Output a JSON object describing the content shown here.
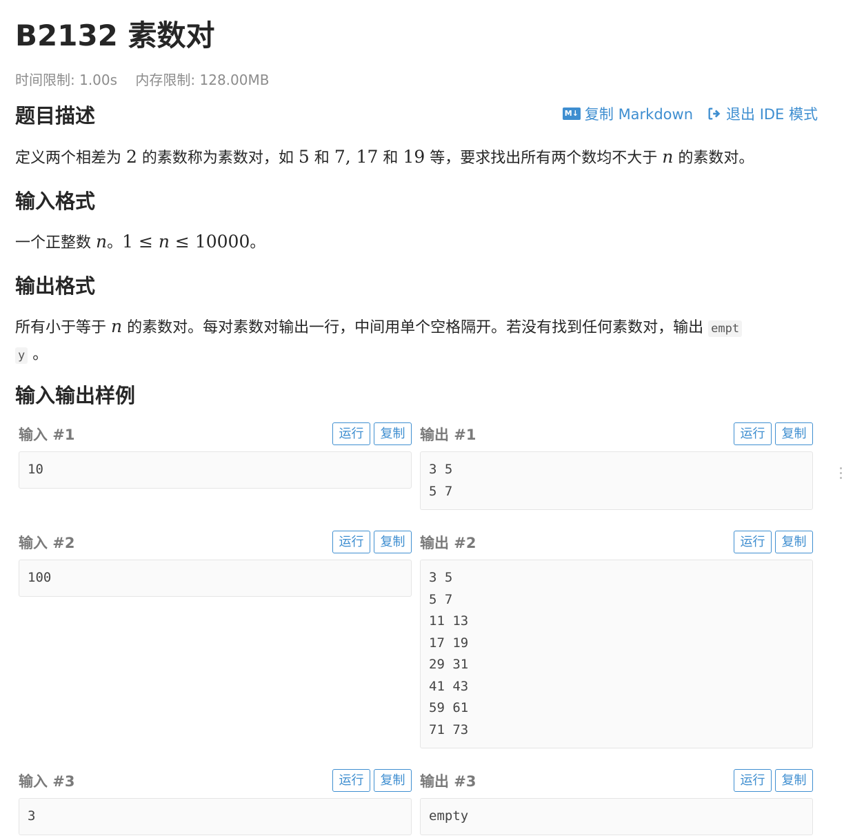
{
  "problem": {
    "title": "B2132 素数对",
    "time_limit": "时间限制: 1.00s",
    "memory_limit": "内存限制: 128.00MB"
  },
  "actions": {
    "copy_markdown": "复制 Markdown",
    "exit_ide": "退出 IDE 模式",
    "md_icon_text": "M↓"
  },
  "sections": {
    "description": {
      "heading": "题目描述",
      "parts": [
        "定义两个相差为 ",
        "2",
        " 的素数称为素数对，如 ",
        "5",
        " 和 ",
        "7, 17",
        " 和 ",
        "19",
        " 等，要求找出所有两个数均不大于 ",
        "n",
        " 的素数对。"
      ]
    },
    "input_format": {
      "heading": "输入格式",
      "parts": [
        "一个正整数 ",
        "n",
        "。",
        "1 ≤ ",
        "n",
        " ≤ 10000",
        "。"
      ]
    },
    "output_format": {
      "heading": "输出格式",
      "line1_parts": [
        "所有小于等于 ",
        "n",
        " 的素数对。每对素数对输出一行，中间用单个空格隔开。若没有找到任何素数对，输出 ",
        "empt"
      ],
      "line2_parts": [
        "y",
        " 。"
      ]
    },
    "samples_heading": "输入输出样例"
  },
  "buttons": {
    "run": "运行",
    "copy": "复制"
  },
  "samples": [
    {
      "input_label": "输入 #1",
      "output_label": "输出 #1",
      "input": [
        "10"
      ],
      "output": [
        "3 5",
        "5 7"
      ]
    },
    {
      "input_label": "输入 #2",
      "output_label": "输出 #2",
      "input": [
        "100"
      ],
      "output": [
        "3 5",
        "5 7",
        "11 13",
        "17 19",
        "29 31",
        "41 43",
        "59 61",
        "71 73"
      ]
    },
    {
      "input_label": "输入 #3",
      "output_label": "输出 #3",
      "input": [
        "3"
      ],
      "output": [
        "empty"
      ]
    }
  ],
  "colors": {
    "accent": "#3e8ed0",
    "text": "#262626",
    "muted": "#8c8c8c",
    "sample_bg": "#fafafa"
  }
}
